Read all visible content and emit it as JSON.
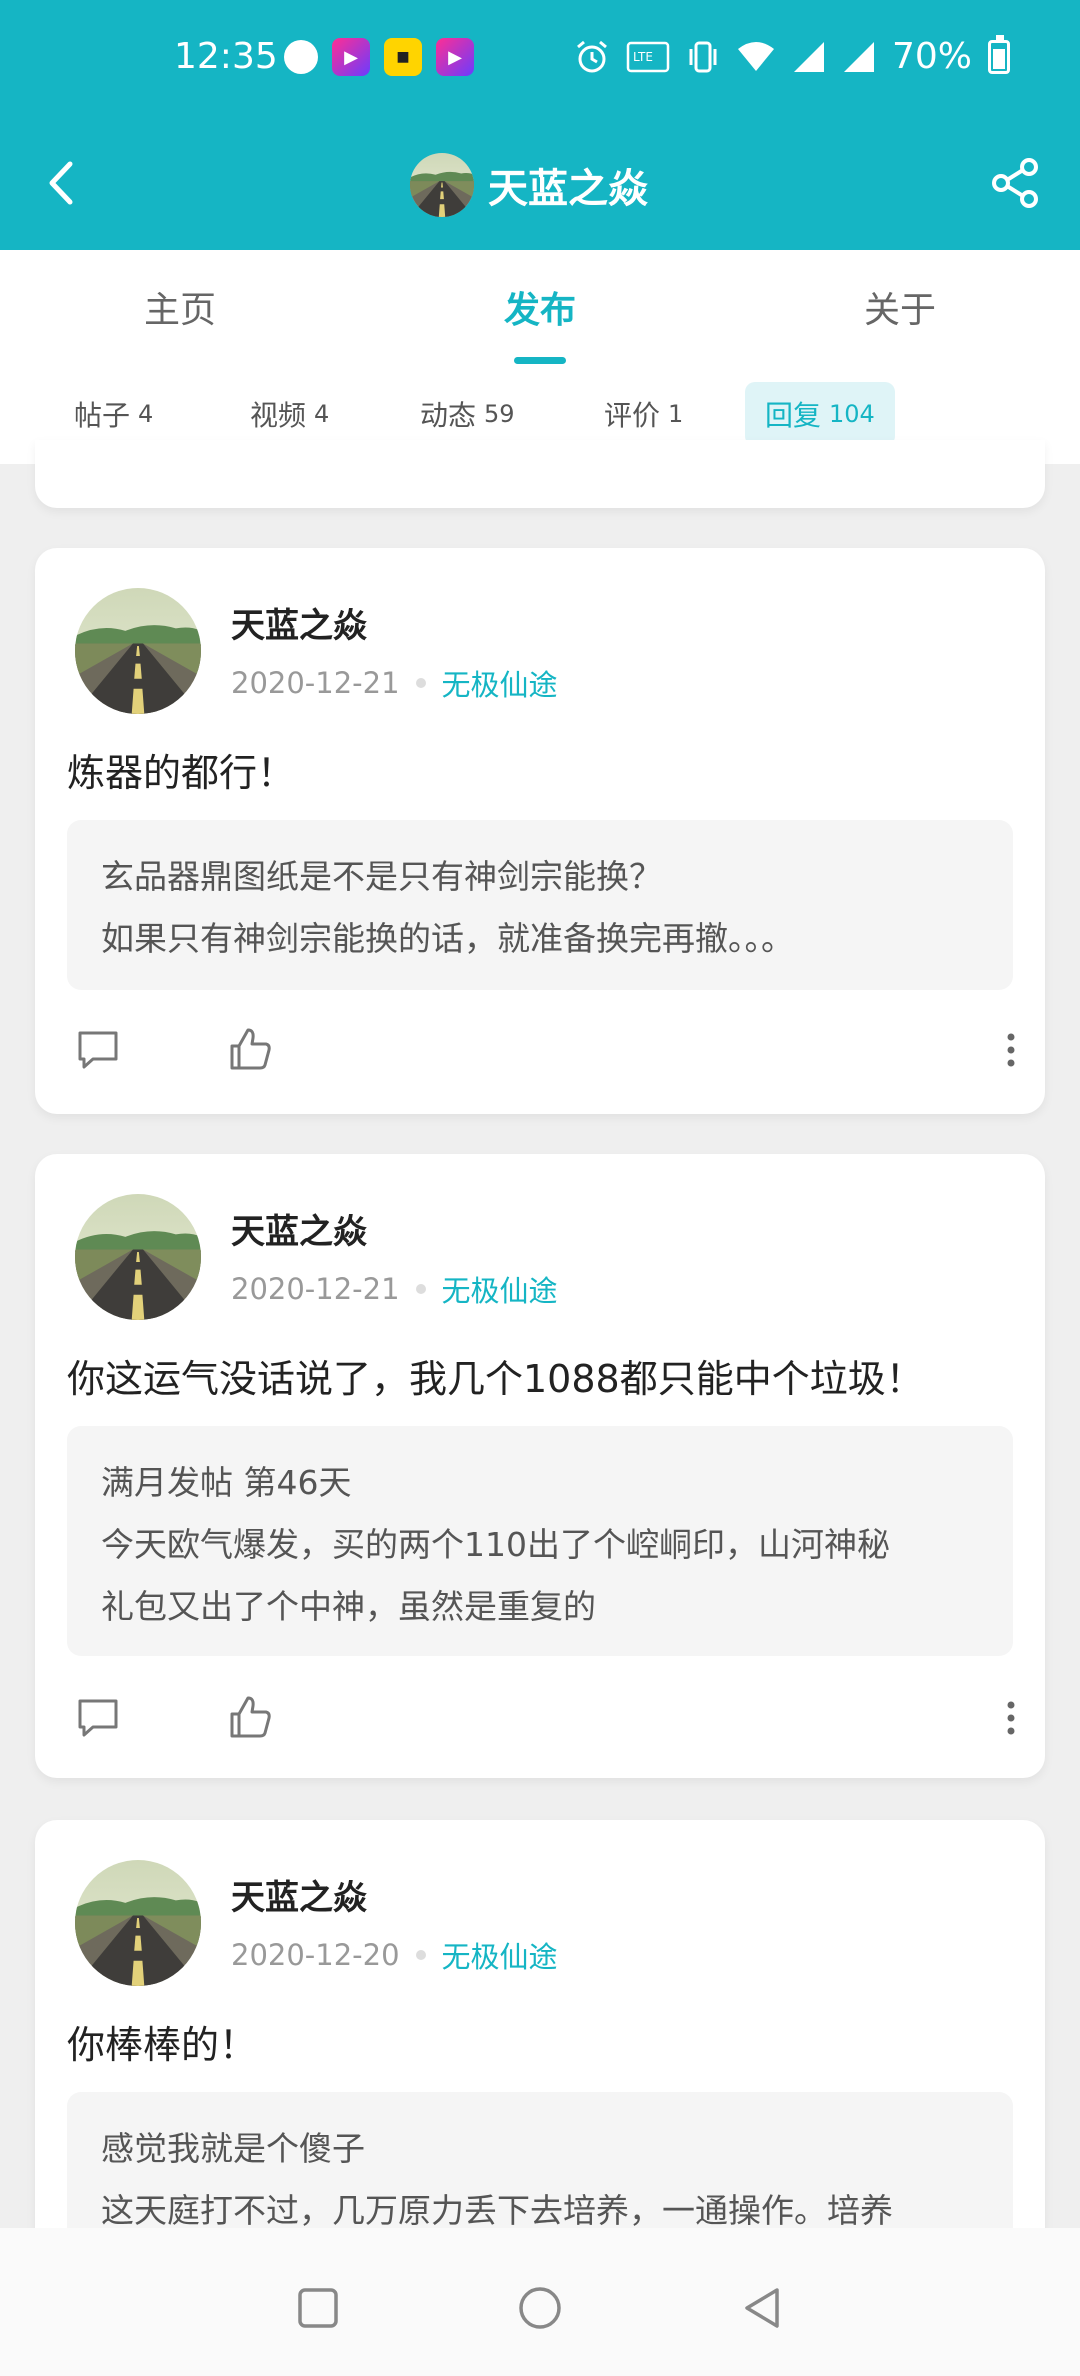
{
  "status": {
    "time": "12:35",
    "battery": "70%"
  },
  "header": {
    "title": "天蓝之焱"
  },
  "tabs": [
    {
      "label": "主页"
    },
    {
      "label": "发布"
    },
    {
      "label": "关于"
    }
  ],
  "subtabs": [
    {
      "label": "帖子",
      "count": "4"
    },
    {
      "label": "视频",
      "count": "4"
    },
    {
      "label": "动态",
      "count": "59"
    },
    {
      "label": "评价",
      "count": "1"
    },
    {
      "label": "回复",
      "count": "104"
    }
  ],
  "posts": [
    {
      "author": "天蓝之焱",
      "date": "2020-12-21",
      "game": "无极仙途",
      "reply": "炼器的都行！",
      "quote": [
        "玄品器鼎图纸是不是只有神剑宗能换？",
        "如果只有神剑宗能换的话，就准备换完再撤。。。"
      ]
    },
    {
      "author": "天蓝之焱",
      "date": "2020-12-21",
      "game": "无极仙途",
      "reply": "你这运气没话说了，我几个1088都只能中个垃圾！",
      "quote": [
        "满月发帖 第46天",
        "今天欧气爆发，买的两个110出了个崆峒印，山河神秘",
        "礼包又出了个中神，虽然是重复的"
      ]
    },
    {
      "author": "天蓝之焱",
      "date": "2020-12-20",
      "game": "无极仙途",
      "reply": "你棒棒的！",
      "quote": [
        "感觉我就是个傻子",
        "这天庭打不过，几万原力丢下去培养，一通操作。培养"
      ]
    }
  ]
}
